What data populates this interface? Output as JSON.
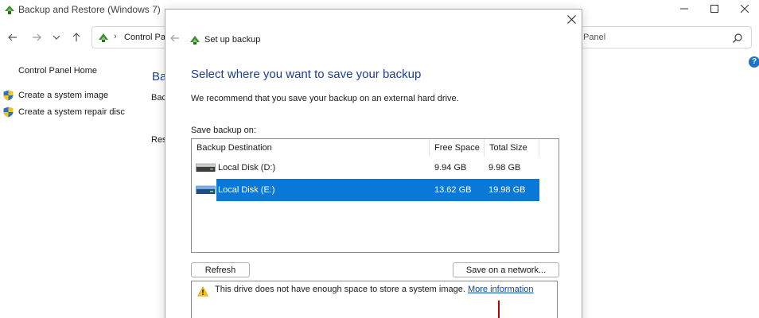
{
  "background_window": {
    "title": "Backup and Restore (Windows 7)",
    "address": {
      "separator": "›",
      "text": "Control Panel"
    },
    "search": {
      "text": "Panel"
    },
    "left_pane": {
      "home": "Control Panel Home",
      "items": [
        {
          "label": "Create a system image",
          "icon": "shield-icon"
        },
        {
          "label": "Create a system repair disc",
          "icon": "shield-icon"
        }
      ]
    },
    "main": {
      "heading_fragment": "Bac",
      "text_fragment_1": "Bac",
      "text_fragment_2": "Rest"
    }
  },
  "dialog": {
    "title": "Set up backup",
    "heading": "Select where you want to save your backup",
    "recommend": "We recommend that you save your backup on an external hard drive.",
    "save_on_label": "Save backup on:",
    "columns": {
      "destination": "Backup Destination",
      "free_space": "Free Space",
      "total_size": "Total Size"
    },
    "rows": [
      {
        "name": "Local Disk (D:)",
        "free": "9.94 GB",
        "total": "9.98 GB",
        "selected": false
      },
      {
        "name": "Local Disk (E:)",
        "free": "13.62 GB",
        "total": "19.98 GB",
        "selected": true
      }
    ],
    "buttons": {
      "refresh": "Refresh",
      "network": "Save on a network..."
    },
    "warning": {
      "text": "This drive does not have enough space to store a system image.",
      "link": "More information"
    }
  },
  "colors": {
    "heading": "#1e3f8a",
    "selection": "#0a78d7",
    "link": "#0645ad",
    "annotation": "#c00000"
  }
}
